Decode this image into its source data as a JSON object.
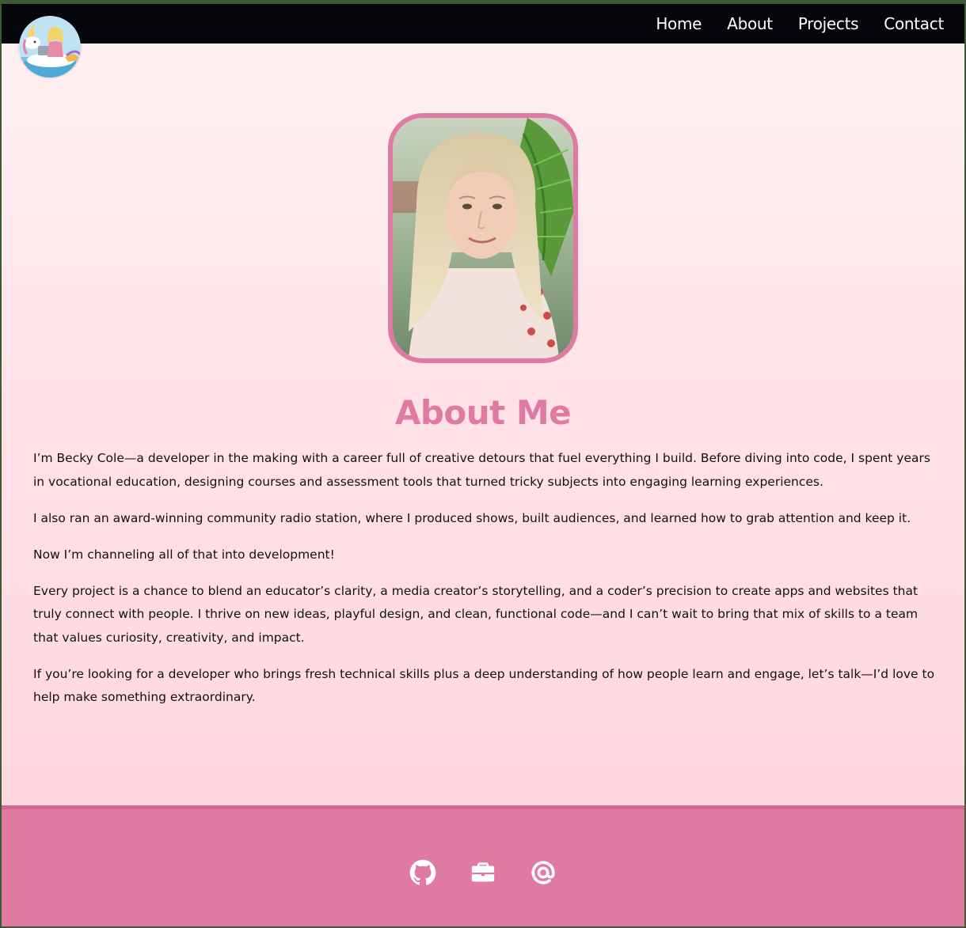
{
  "nav": {
    "items": [
      {
        "label": "Home"
      },
      {
        "label": "About"
      },
      {
        "label": "Projects"
      },
      {
        "label": "Contact"
      }
    ]
  },
  "logo": {
    "icon": "unicorn-avatar-icon"
  },
  "profile_photo": {
    "icon": "portrait-photo"
  },
  "main": {
    "title": "About Me",
    "paragraphs": [
      "I’m Becky Cole—a developer in the making with a career full of creative detours that fuel everything I build. Before diving into code, I spent years in vocational education, designing courses and assessment tools that turned tricky subjects into engaging learning experiences.",
      "I also ran an award-winning community radio station, where I produced shows, built audiences, and learned how to grab attention and keep it.",
      "Now I’m channeling all of that into development!",
      "Every project is a chance to blend an educator’s clarity, a media creator’s storytelling, and a coder’s precision to create apps and websites that truly connect with people. I thrive on new ideas, playful design, and clean, functional code—and I can’t wait to bring that mix of skills to a team that values curiosity, creativity, and impact.",
      "If you’re looking for a developer who brings fresh technical skills plus a deep understanding of how people learn and engage, let’s talk—I’d love to help make something extraordinary."
    ]
  },
  "footer": {
    "icons": [
      "github-icon",
      "briefcase-icon",
      "at-sign-icon"
    ]
  },
  "colors": {
    "accent": "#df7aa3",
    "nav_background": "#05050c",
    "page_background_top": "#fff2f3",
    "page_background_bottom": "#ffd3dc",
    "text": "#111111"
  }
}
